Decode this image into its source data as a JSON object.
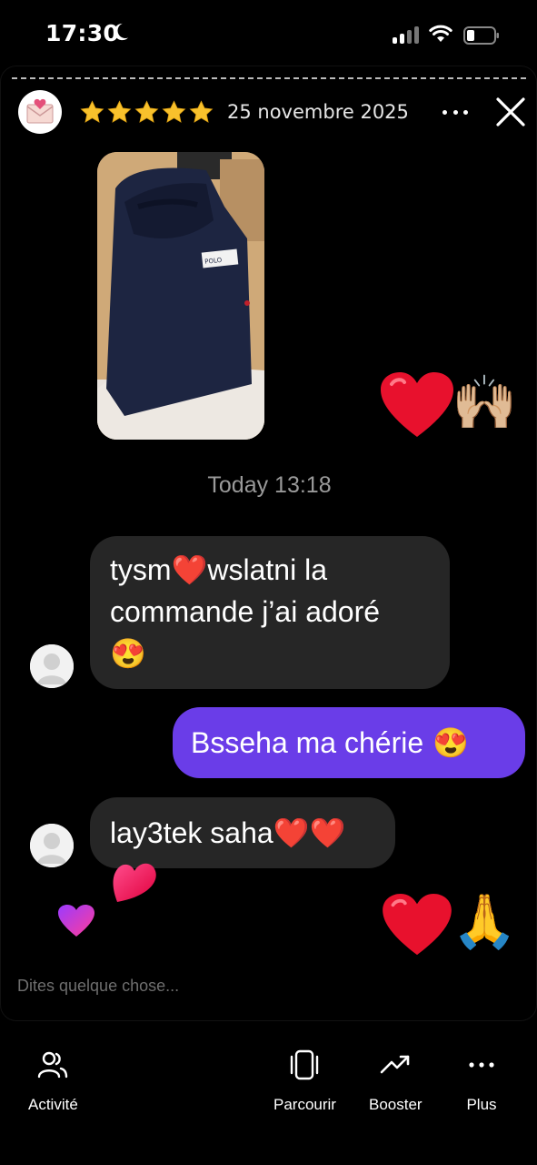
{
  "status_bar": {
    "time": "17:30",
    "icons": [
      "moon-icon",
      "signal-icon",
      "wifi-icon",
      "battery-icon"
    ]
  },
  "story": {
    "rating_stars": 5,
    "date": "25 novembre 2025",
    "photo_alt": "navy-hoodie-photo",
    "photo_label_text": "POLO"
  },
  "chat": {
    "timestamp": "Today 13:18",
    "messages": [
      {
        "direction": "in",
        "text_before": "tysm",
        "emoji_mid": "❤️",
        "text_after": "wslatni la",
        "line2": "commande j’ai adoré",
        "line3_emoji": "😍"
      },
      {
        "direction": "out",
        "text": "Bsseha ma chérie",
        "emoji": "😍"
      },
      {
        "direction": "in",
        "text": "lay3tek saha",
        "emoji": "❤️❤️"
      }
    ],
    "reactions": [
      "❤️",
      "🙌🏼",
      "❤️",
      "🙏"
    ]
  },
  "input": {
    "placeholder": "Dites quelque chose..."
  },
  "bottom_nav": {
    "items": [
      {
        "label": "Activité",
        "icon": "people-icon"
      },
      {
        "label": "Parcourir",
        "icon": "phone-frame-icon"
      },
      {
        "label": "Booster",
        "icon": "trend-up-icon"
      },
      {
        "label": "Plus",
        "icon": "more-dots-icon"
      }
    ]
  },
  "colors": {
    "background": "#000000",
    "incoming_bubble": "#262626",
    "outgoing_bubble": "#6a3de8",
    "star": "#f8c12c"
  }
}
